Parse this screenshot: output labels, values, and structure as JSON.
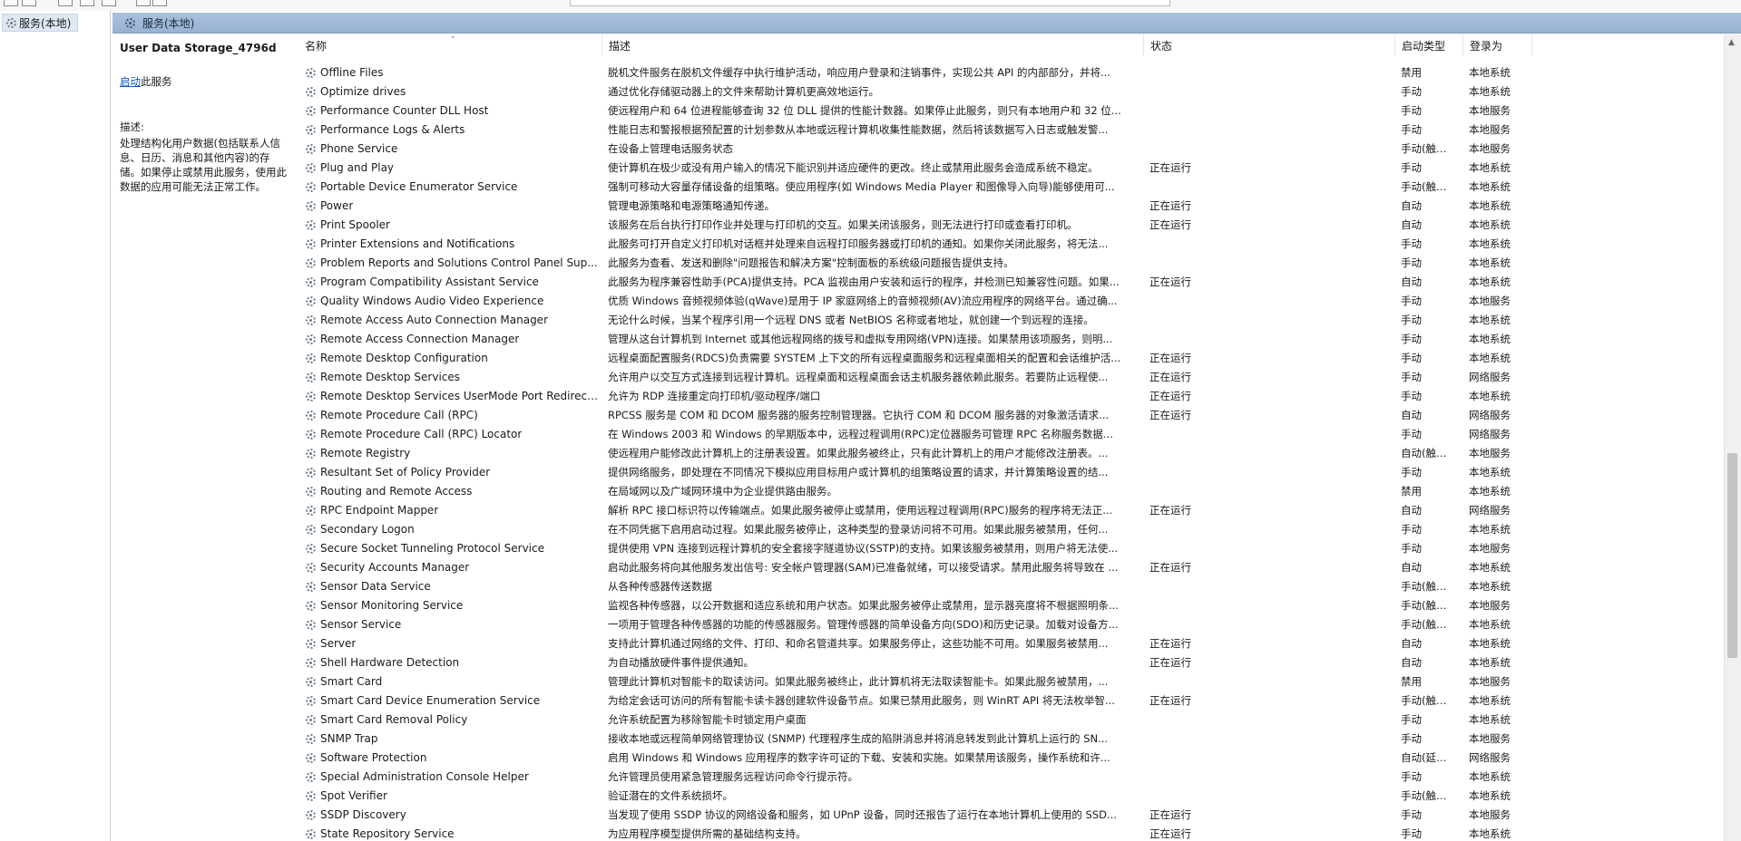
{
  "tree": {
    "item_label": "服务(本地)"
  },
  "main": {
    "header_title": "服务(本地)"
  },
  "details": {
    "service_title": "User Data Storage_4796d",
    "action_link": "启动",
    "action_suffix": "此服务",
    "desc_label": "描述:",
    "desc_text": "处理结构化用户数据(包括联系人信息、日历、消息和其他内容)的存储。如果停止或禁用此服务，使用此数据的应用可能无法正常工作。"
  },
  "columns": {
    "name": "名称",
    "desc": "描述",
    "status": "状态",
    "start": "启动类型",
    "logon": "登录为"
  },
  "rows": [
    {
      "name": "Offline Files",
      "desc": "脱机文件服务在脱机文件缓存中执行维护活动，响应用户登录和注销事件，实现公共 API 的内部部分，并将...",
      "status": "",
      "start": "禁用",
      "logon": "本地系统"
    },
    {
      "name": "Optimize drives",
      "desc": "通过优化存储驱动器上的文件来帮助计算机更高效地运行。",
      "status": "",
      "start": "手动",
      "logon": "本地系统"
    },
    {
      "name": "Performance Counter DLL Host",
      "desc": "使远程用户和 64 位进程能够查询 32 位 DLL 提供的性能计数器。如果停止此服务，则只有本地用户和 32 位...",
      "status": "",
      "start": "手动",
      "logon": "本地服务"
    },
    {
      "name": "Performance Logs & Alerts",
      "desc": "性能日志和警报根据预配置的计划参数从本地或远程计算机收集性能数据，然后将该数据写入日志或触发警...",
      "status": "",
      "start": "手动",
      "logon": "本地服务"
    },
    {
      "name": "Phone Service",
      "desc": "在设备上管理电话服务状态",
      "status": "",
      "start": "手动(触发...",
      "logon": "本地服务"
    },
    {
      "name": "Plug and Play",
      "desc": "使计算机在极少或没有用户输入的情况下能识别并适应硬件的更改。终止或禁用此服务会造成系统不稳定。",
      "status": "正在运行",
      "start": "手动",
      "logon": "本地系统"
    },
    {
      "name": "Portable Device Enumerator Service",
      "desc": "强制可移动大容量存储设备的组策略。使应用程序(如 Windows Media Player 和图像导入向导)能够使用可...",
      "status": "",
      "start": "手动(触发...",
      "logon": "本地系统"
    },
    {
      "name": "Power",
      "desc": "管理电源策略和电源策略通知传递。",
      "status": "正在运行",
      "start": "自动",
      "logon": "本地系统"
    },
    {
      "name": "Print Spooler",
      "desc": "该服务在后台执行打印作业并处理与打印机的交互。如果关闭该服务，则无法进行打印或查看打印机。",
      "status": "正在运行",
      "start": "自动",
      "logon": "本地系统"
    },
    {
      "name": "Printer Extensions and Notifications",
      "desc": "此服务可打开自定义打印机对话框并处理来自远程打印服务器或打印机的通知。如果你关闭此服务，将无法...",
      "status": "",
      "start": "手动",
      "logon": "本地系统"
    },
    {
      "name": "Problem Reports and Solutions Control Panel Sup...",
      "desc": "此服务为查看、发送和删除\"问题报告和解决方案\"控制面板的系统级问题报告提供支持。",
      "status": "",
      "start": "手动",
      "logon": "本地系统"
    },
    {
      "name": "Program Compatibility Assistant Service",
      "desc": "此服务为程序兼容性助手(PCA)提供支持。PCA 监视由用户安装和运行的程序，并检测已知兼容性问题。如果...",
      "status": "正在运行",
      "start": "自动",
      "logon": "本地系统"
    },
    {
      "name": "Quality Windows Audio Video Experience",
      "desc": "优质 Windows 音频视频体验(qWave)是用于 IP 家庭网络上的音频视频(AV)流应用程序的网络平台。通过确...",
      "status": "",
      "start": "手动",
      "logon": "本地服务"
    },
    {
      "name": "Remote Access Auto Connection Manager",
      "desc": "无论什么时候，当某个程序引用一个远程 DNS 或者 NetBIOS 名称或者地址，就创建一个到远程的连接。",
      "status": "",
      "start": "手动",
      "logon": "本地系统"
    },
    {
      "name": "Remote Access Connection Manager",
      "desc": "管理从这台计算机到 Internet 或其他远程网络的拨号和虚拟专用网络(VPN)连接。如果禁用该项服务，则明...",
      "status": "",
      "start": "手动",
      "logon": "本地系统"
    },
    {
      "name": "Remote Desktop Configuration",
      "desc": "远程桌面配置服务(RDCS)负责需要 SYSTEM 上下文的所有远程桌面服务和远程桌面相关的配置和会话维护活...",
      "status": "正在运行",
      "start": "手动",
      "logon": "本地系统"
    },
    {
      "name": "Remote Desktop Services",
      "desc": "允许用户以交互方式连接到远程计算机。远程桌面和远程桌面会话主机服务器依赖此服务。若要防止远程使...",
      "status": "正在运行",
      "start": "手动",
      "logon": "网络服务"
    },
    {
      "name": "Remote Desktop Services UserMode Port Redirect...",
      "desc": "允许为 RDP 连接重定向打印机/驱动程序/端口",
      "status": "正在运行",
      "start": "手动",
      "logon": "本地系统"
    },
    {
      "name": "Remote Procedure Call (RPC)",
      "desc": "RPCSS 服务是 COM 和 DCOM 服务器的服务控制管理器。它执行 COM 和 DCOM 服务器的对象激活请求...",
      "status": "正在运行",
      "start": "自动",
      "logon": "网络服务"
    },
    {
      "name": "Remote Procedure Call (RPC) Locator",
      "desc": "在 Windows 2003 和 Windows 的早期版本中，远程过程调用(RPC)定位器服务可管理 RPC 名称服务数据...",
      "status": "",
      "start": "手动",
      "logon": "网络服务"
    },
    {
      "name": "Remote Registry",
      "desc": "使远程用户能修改此计算机上的注册表设置。如果此服务被终止，只有此计算机上的用户才能修改注册表。...",
      "status": "",
      "start": "自动(触发...",
      "logon": "本地服务"
    },
    {
      "name": "Resultant Set of Policy Provider",
      "desc": "提供网络服务，即处理在不同情况下模拟应用目标用户或计算机的组策略设置的请求，并计算策略设置的结...",
      "status": "",
      "start": "手动",
      "logon": "本地系统"
    },
    {
      "name": "Routing and Remote Access",
      "desc": "在局域网以及广域网环境中为企业提供路由服务。",
      "status": "",
      "start": "禁用",
      "logon": "本地系统"
    },
    {
      "name": "RPC Endpoint Mapper",
      "desc": "解析 RPC 接口标识符以传输端点。如果此服务被停止或禁用，使用远程过程调用(RPC)服务的程序将无法正...",
      "status": "正在运行",
      "start": "自动",
      "logon": "网络服务"
    },
    {
      "name": "Secondary Logon",
      "desc": "在不同凭据下启用启动过程。如果此服务被停止，这种类型的登录访问将不可用。如果此服务被禁用，任何...",
      "status": "",
      "start": "手动",
      "logon": "本地系统"
    },
    {
      "name": "Secure Socket Tunneling Protocol Service",
      "desc": "提供使用 VPN 连接到远程计算机的安全套接字隧道协议(SSTP)的支持。如果该服务被禁用，则用户将无法使...",
      "status": "",
      "start": "手动",
      "logon": "本地服务"
    },
    {
      "name": "Security Accounts Manager",
      "desc": "启动此服务将向其他服务发出信号: 安全帐户管理器(SAM)已准备就绪，可以接受请求。禁用此服务将导致在 ...",
      "status": "正在运行",
      "start": "自动",
      "logon": "本地系统"
    },
    {
      "name": "Sensor Data Service",
      "desc": "从各种传感器传送数据",
      "status": "",
      "start": "手动(触发...",
      "logon": "本地系统"
    },
    {
      "name": "Sensor Monitoring Service",
      "desc": "监视各种传感器，以公开数据和适应系统和用户状态。如果此服务被停止或禁用，显示器亮度将不根据照明条...",
      "status": "",
      "start": "手动(触发...",
      "logon": "本地服务"
    },
    {
      "name": "Sensor Service",
      "desc": "一项用于管理各种传感器的功能的传感器服务。管理传感器的简单设备方向(SDO)和历史记录。加载对设备方...",
      "status": "",
      "start": "手动(触发...",
      "logon": "本地系统"
    },
    {
      "name": "Server",
      "desc": "支持此计算机通过网络的文件、打印、和命名管道共享。如果服务停止，这些功能不可用。如果服务被禁用...",
      "status": "正在运行",
      "start": "自动",
      "logon": "本地系统"
    },
    {
      "name": "Shell Hardware Detection",
      "desc": "为自动播放硬件事件提供通知。",
      "status": "正在运行",
      "start": "自动",
      "logon": "本地系统"
    },
    {
      "name": "Smart Card",
      "desc": "管理此计算机对智能卡的取读访问。如果此服务被终止，此计算机将无法取读智能卡。如果此服务被禁用，...",
      "status": "",
      "start": "禁用",
      "logon": "本地服务"
    },
    {
      "name": "Smart Card Device Enumeration Service",
      "desc": "为给定会话可访问的所有智能卡读卡器创建软件设备节点。如果已禁用此服务，则 WinRT API 将无法枚举智...",
      "status": "正在运行",
      "start": "手动(触发...",
      "logon": "本地系统"
    },
    {
      "name": "Smart Card Removal Policy",
      "desc": "允许系统配置为移除智能卡时锁定用户桌面",
      "status": "",
      "start": "手动",
      "logon": "本地系统"
    },
    {
      "name": "SNMP Trap",
      "desc": "接收本地或远程简单网络管理协议 (SNMP) 代理程序生成的陷阱消息并将消息转发到此计算机上运行的 SN...",
      "status": "",
      "start": "手动",
      "logon": "本地服务"
    },
    {
      "name": "Software Protection",
      "desc": "启用 Windows 和 Windows 应用程序的数字许可证的下载、安装和实施。如果禁用该服务，操作系统和许...",
      "status": "",
      "start": "自动(延迟...",
      "logon": "网络服务"
    },
    {
      "name": "Special Administration Console Helper",
      "desc": "允许管理员使用紧急管理服务远程访问命令行提示符。",
      "status": "",
      "start": "手动",
      "logon": "本地系统"
    },
    {
      "name": "Spot Verifier",
      "desc": "验证潜在的文件系统损坏。",
      "status": "",
      "start": "手动(触发...",
      "logon": "本地系统"
    },
    {
      "name": "SSDP Discovery",
      "desc": "当发现了使用 SSDP 协议的网络设备和服务，如 UPnP 设备，同时还报告了运行在本地计算机上使用的 SSD...",
      "status": "正在运行",
      "start": "手动",
      "logon": "本地服务"
    },
    {
      "name": "State Repository Service",
      "desc": "为应用程序模型提供所需的基础结构支持。",
      "status": "正在运行",
      "start": "手动",
      "logon": "本地系统"
    }
  ]
}
